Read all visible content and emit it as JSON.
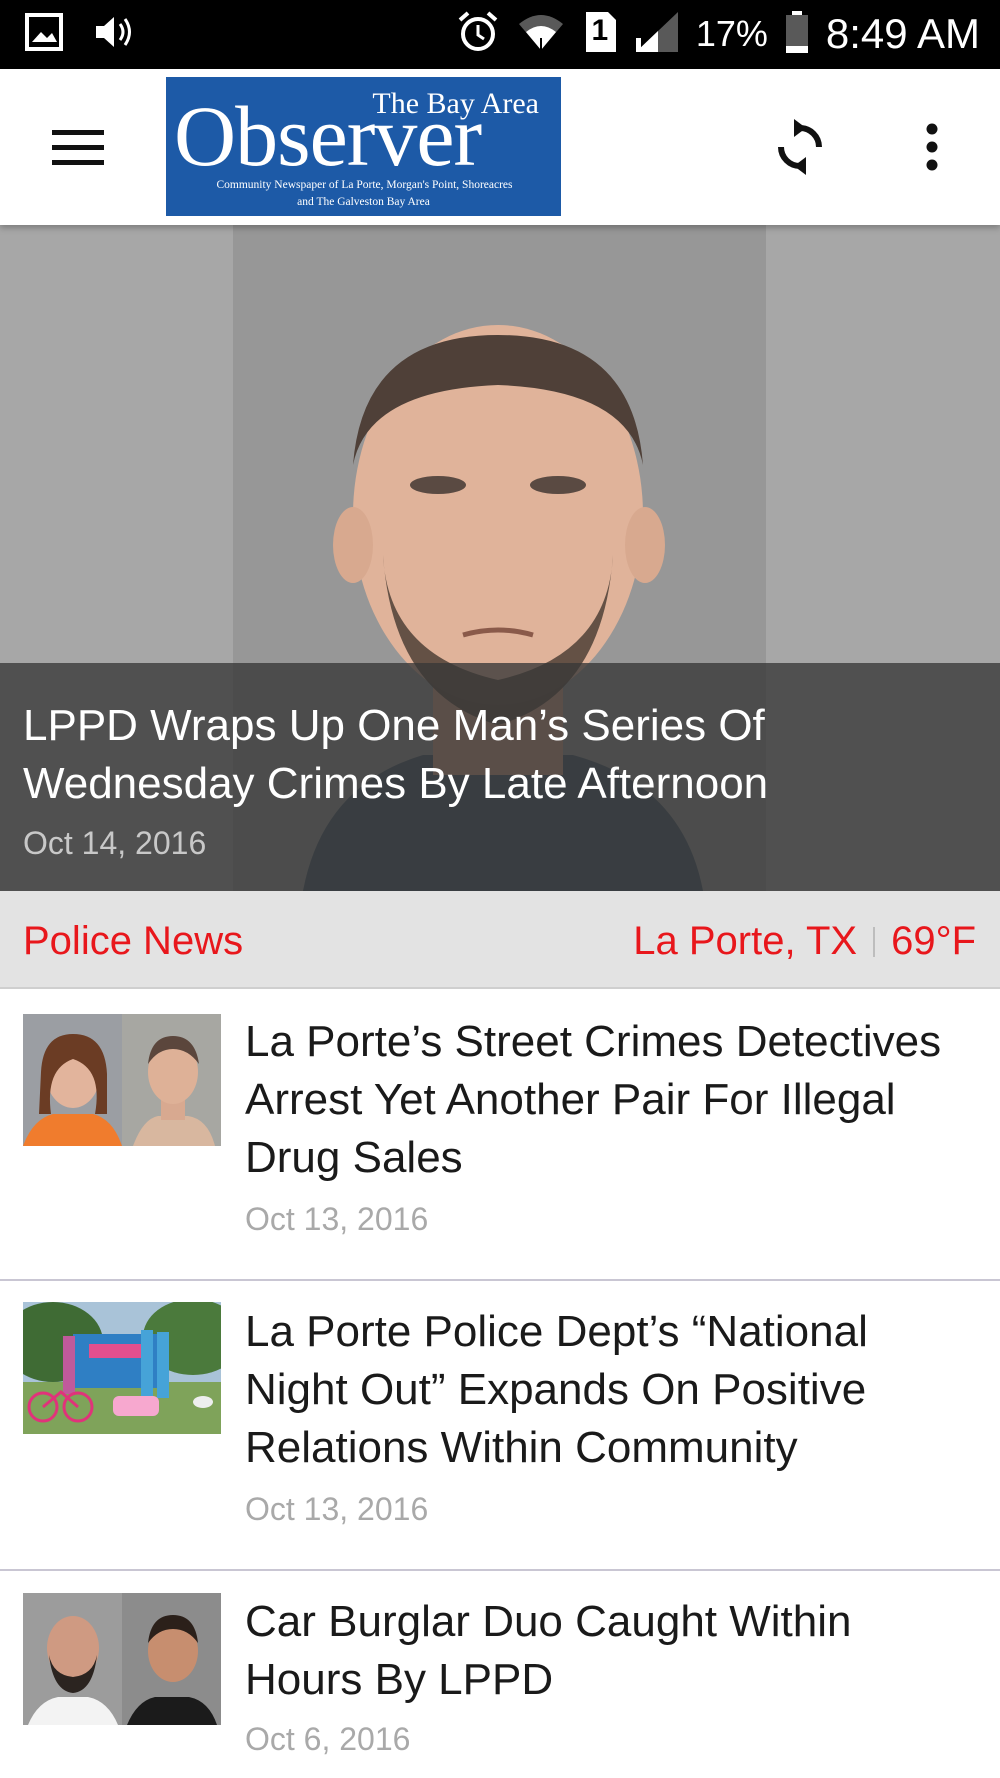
{
  "status_bar": {
    "battery": "17%",
    "sim": "1",
    "time": "8:49 AM"
  },
  "app_bar": {
    "logo": {
      "top_line": "The Bay Area",
      "name": "Observer",
      "tagline_1": "Community Newspaper of La Porte, Morgan's Point, Shoreacres",
      "tagline_2": "and The Galveston Bay Area"
    }
  },
  "hero": {
    "title": "LPPD Wraps Up One Man’s Series Of Wednesday Crimes By Late Afternoon",
    "date": "Oct 14, 2016"
  },
  "section": {
    "title": "Police News",
    "location": "La Porte, TX",
    "temperature": "69°F"
  },
  "articles": [
    {
      "title": "La Porte’s Street Crimes Detectives Arrest Yet Another Pair For Illegal Drug Sales",
      "date": "Oct 13, 2016"
    },
    {
      "title": "La Porte Police Dept’s “National Night Out” Expands On Positive Relations Within Community",
      "date": "Oct 13, 2016"
    },
    {
      "title": "Car Burglar Duo Caught Within Hours By LPPD",
      "date": "Oct 6, 2016"
    }
  ]
}
